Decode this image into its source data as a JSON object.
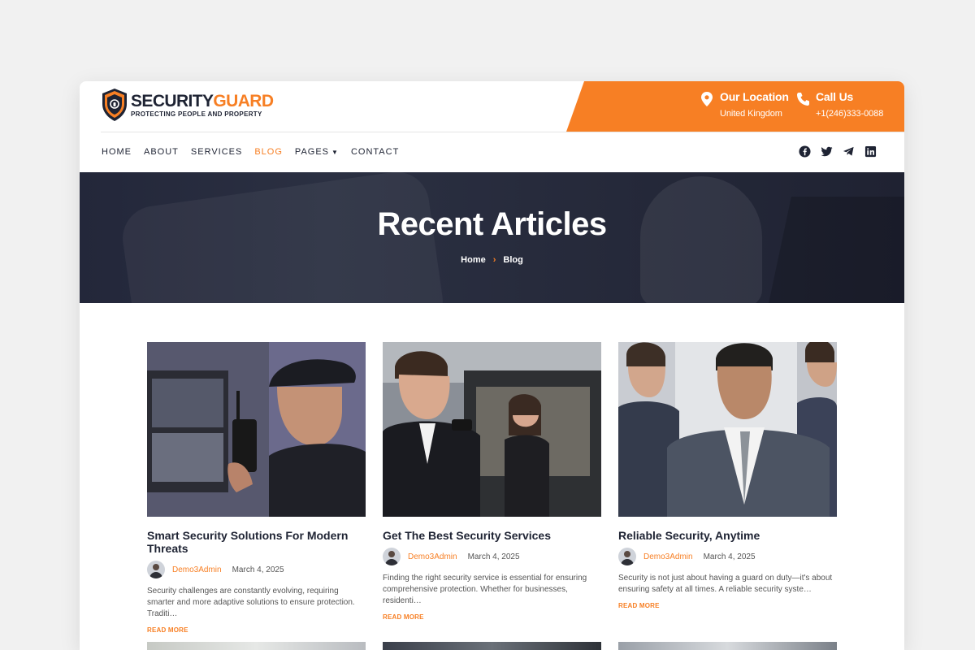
{
  "logo": {
    "title_part1": "SECURITY",
    "title_part2": "GUARD",
    "tagline": "PROTECTING PEOPLE AND PROPERTY"
  },
  "contact": {
    "location": {
      "label": "Our Location",
      "value": "United Kingdom",
      "icon": "location-pin-icon"
    },
    "call": {
      "label": "Call Us",
      "value": "+1(246)333-0088",
      "icon": "phone-icon"
    }
  },
  "nav": {
    "items": [
      "HOME",
      "ABOUT",
      "SERVICES",
      "BLOG",
      "PAGES",
      "CONTACT"
    ],
    "active": "BLOG"
  },
  "social": [
    "facebook-icon",
    "twitter-icon",
    "telegram-icon",
    "linkedin-icon"
  ],
  "hero": {
    "title": "Recent Articles",
    "breadcrumb": [
      "Home",
      "Blog"
    ]
  },
  "posts": [
    {
      "title": "Smart Security Solutions For Modern Threats",
      "author": "Demo3Admin",
      "date": "March 4, 2025",
      "excerpt": "Security challenges are constantly evolving, requiring smarter and more adaptive solutions to ensure protection. Traditi…",
      "read_more": "READ MORE"
    },
    {
      "title": "Get The Best Security Services",
      "author": "Demo3Admin",
      "date": "March 4, 2025",
      "excerpt": "Finding the right security service is essential for ensuring comprehensive protection. Whether for businesses, residenti…",
      "read_more": "READ MORE"
    },
    {
      "title": "Reliable Security, Anytime",
      "author": "Demo3Admin",
      "date": "March 4, 2025",
      "excerpt": "Security is not just about having a guard on duty—it's about ensuring safety at all times. A reliable security syste…",
      "read_more": "READ MORE"
    }
  ],
  "colors": {
    "accent": "#f77f24",
    "dark": "#1e2333",
    "hero_bg": "#262a3b"
  }
}
